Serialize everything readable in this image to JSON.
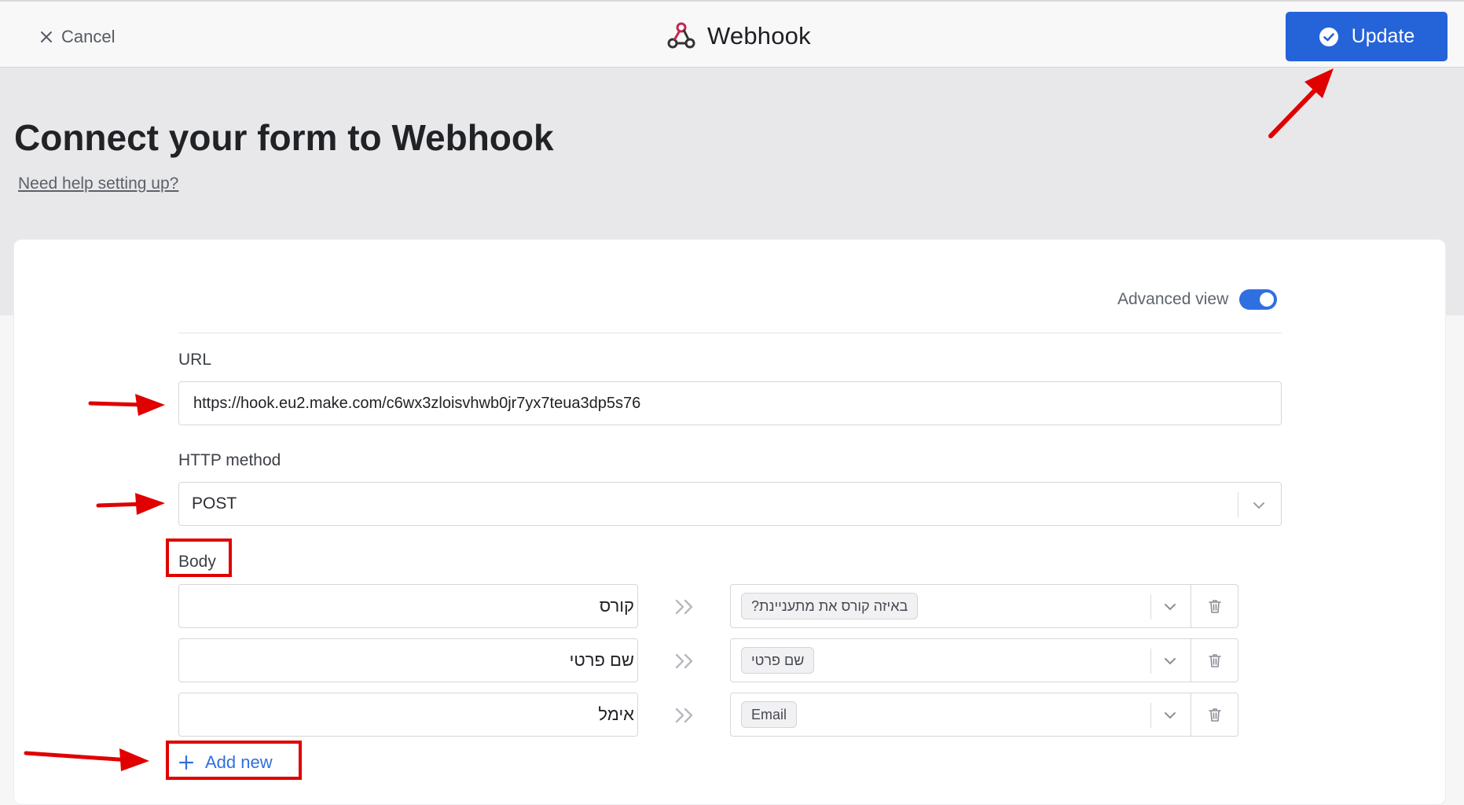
{
  "topbar": {
    "cancel_label": "Cancel",
    "app_title": "Webhook",
    "update_label": "Update"
  },
  "header": {
    "title": "Connect your form to Webhook",
    "help_link": "Need help setting up?"
  },
  "advanced_view": {
    "label": "Advanced view",
    "enabled": true
  },
  "url_field": {
    "label": "URL",
    "value": "https://hook.eu2.make.com/c6wx3zloisvhwb0jr7yx7teua3dp5s76"
  },
  "http_method": {
    "label": "HTTP method",
    "value": "POST"
  },
  "body": {
    "label": "Body",
    "rows": [
      {
        "key": "קורס",
        "value": "באיזה קורס את מתעניינת?"
      },
      {
        "key": "שם פרטי",
        "value": "שם פרטי"
      },
      {
        "key": "אימל",
        "value": "Email"
      }
    ],
    "add_new_label": "Add new"
  },
  "colors": {
    "primary": "#2563d9",
    "annotation": "#e00000"
  }
}
